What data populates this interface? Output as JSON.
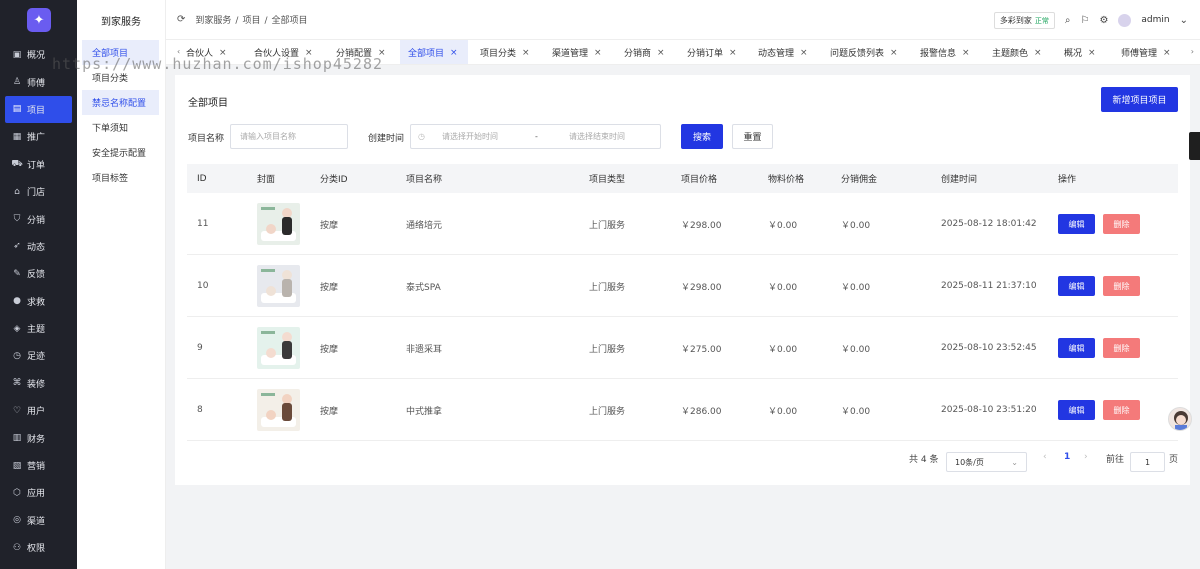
{
  "sidebar": {
    "logo_icon": "puzzle-icon",
    "items": [
      {
        "label": "概况",
        "icon": "dashboard-icon"
      },
      {
        "label": "师傅",
        "icon": "user-icon"
      },
      {
        "label": "项目",
        "icon": "project-icon",
        "active": true
      },
      {
        "label": "推广",
        "icon": "promote-icon"
      },
      {
        "label": "订单",
        "icon": "cart-icon"
      },
      {
        "label": "门店",
        "icon": "store-icon"
      },
      {
        "label": "分销",
        "icon": "share-icon"
      },
      {
        "label": "动态",
        "icon": "send-icon"
      },
      {
        "label": "反馈",
        "icon": "feedback-icon"
      },
      {
        "label": "求救",
        "icon": "help-icon"
      },
      {
        "label": "主题",
        "icon": "theme-icon"
      },
      {
        "label": "足迹",
        "icon": "clock-icon"
      },
      {
        "label": "装修",
        "icon": "decor-icon"
      },
      {
        "label": "用户",
        "icon": "users-icon"
      },
      {
        "label": "财务",
        "icon": "finance-icon"
      },
      {
        "label": "营销",
        "icon": "marketing-icon"
      },
      {
        "label": "应用",
        "icon": "app-icon"
      },
      {
        "label": "渠道",
        "icon": "channel-icon"
      },
      {
        "label": "权限",
        "icon": "permission-icon"
      }
    ]
  },
  "subnav": {
    "title": "到家服务",
    "items": [
      {
        "label": "全部项目",
        "active": true
      },
      {
        "label": "项目分类"
      },
      {
        "label": "禁忌名称配置",
        "highlight": true
      },
      {
        "label": "下单须知"
      },
      {
        "label": "安全提示配置"
      },
      {
        "label": "项目标签"
      }
    ]
  },
  "header": {
    "breadcrumb": [
      "到家服务",
      "项目",
      "全部项目"
    ],
    "badge_label": "多彩到家",
    "badge_status": "正常",
    "user": "admin"
  },
  "tabs": [
    {
      "label": "合伙人"
    },
    {
      "label": "合伙人设置"
    },
    {
      "label": "分销配置"
    },
    {
      "label": "全部项目",
      "active": true
    },
    {
      "label": "项目分类"
    },
    {
      "label": "渠道管理"
    },
    {
      "label": "分销商"
    },
    {
      "label": "分销订单"
    },
    {
      "label": "动态管理"
    },
    {
      "label": "问题反馈列表"
    },
    {
      "label": "报警信息"
    },
    {
      "label": "主题颜色"
    },
    {
      "label": "概况"
    },
    {
      "label": "师傅管理"
    }
  ],
  "watermark": "https://www.huzhan.com/ishop45282",
  "main": {
    "title": "全部项目",
    "new_button": "新增项目项目",
    "filter": {
      "name_label": "项目名称",
      "name_placeholder": "请输入项目名称",
      "time_label": "创建时间",
      "start_placeholder": "请选择开始时间",
      "range_sep": "-",
      "end_placeholder": "请选择结束时间",
      "search_button": "搜索",
      "reset_button": "重置"
    },
    "columns": [
      "ID",
      "封面",
      "分类ID",
      "项目名称",
      "项目类型",
      "项目价格",
      "物料价格",
      "分销佣金",
      "创建时间",
      "操作"
    ],
    "rows": [
      {
        "id": "11",
        "category": "按摩",
        "name": "通络培元",
        "type": "上门服务",
        "price": "￥298.00",
        "material": "￥0.00",
        "commission": "￥0.00",
        "created": "2025-08-12 18:01:42",
        "edit": "编辑",
        "del": "删除"
      },
      {
        "id": "10",
        "category": "按摩",
        "name": "泰式SPA",
        "type": "上门服务",
        "price": "￥298.00",
        "material": "￥0.00",
        "commission": "￥0.00",
        "created": "2025-08-11 21:37:10",
        "edit": "编辑",
        "del": "删除"
      },
      {
        "id": "9",
        "category": "按摩",
        "name": "非遗采耳",
        "type": "上门服务",
        "price": "￥275.00",
        "material": "￥0.00",
        "commission": "￥0.00",
        "created": "2025-08-10 23:52:45",
        "edit": "编辑",
        "del": "删除"
      },
      {
        "id": "8",
        "category": "按摩",
        "name": "中式推拿",
        "type": "上门服务",
        "price": "￥286.00",
        "material": "￥0.00",
        "commission": "￥0.00",
        "created": "2025-08-10 23:51:20",
        "edit": "编辑",
        "del": "删除"
      }
    ],
    "pagination": {
      "total": "共 4 条",
      "page_size": "10条/页",
      "current": "1",
      "goto_label": "前往",
      "goto_value": "1",
      "page_suffix": "页"
    }
  },
  "colors": {
    "primary": "#2236e2",
    "danger": "#f47a7a",
    "sidebar": "#20222a"
  }
}
